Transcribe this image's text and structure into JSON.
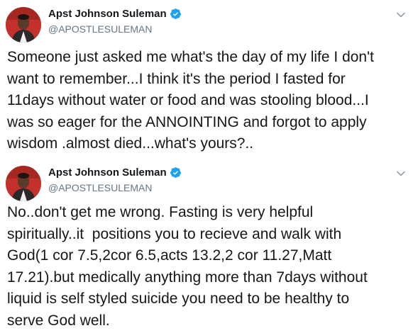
{
  "tweets": [
    {
      "display_name": "Apst Johnson Suleman",
      "handle": "@APOSTLESULEMAN",
      "verified": true,
      "text": "Someone just asked me what's the day of my life I don't\nwant to remember...I think it's the period I fasted for\n11days without water or food and was stooling blood...I\nwas so eager for the ANNOINTING and forgot to apply\nwisdom .almost died...what's yours?..",
      "icons": {
        "verified": "verified-badge-icon",
        "menu": "chevron-down-icon"
      }
    },
    {
      "display_name": "Apst Johnson Suleman",
      "handle": "@APOSTLESULEMAN",
      "verified": true,
      "text": "No..don't get me wrong. Fasting is very helpful\nspiritually..it  positions you to recieve and walk with\nGod(1 cor 7.5,2cor 6.5,acts 13.2,2 cor 11.27,Matt\n17.21).but medically anything more than 7days without\nliquid is self styled suicide you need to be healthy to\nserve God well.",
      "icons": {
        "verified": "verified-badge-icon",
        "menu": "chevron-down-icon"
      }
    }
  ],
  "colors": {
    "text": "#14171a",
    "secondary_text": "#657786",
    "verified": "#1da1f2",
    "avatar_background": "#c4302b"
  }
}
